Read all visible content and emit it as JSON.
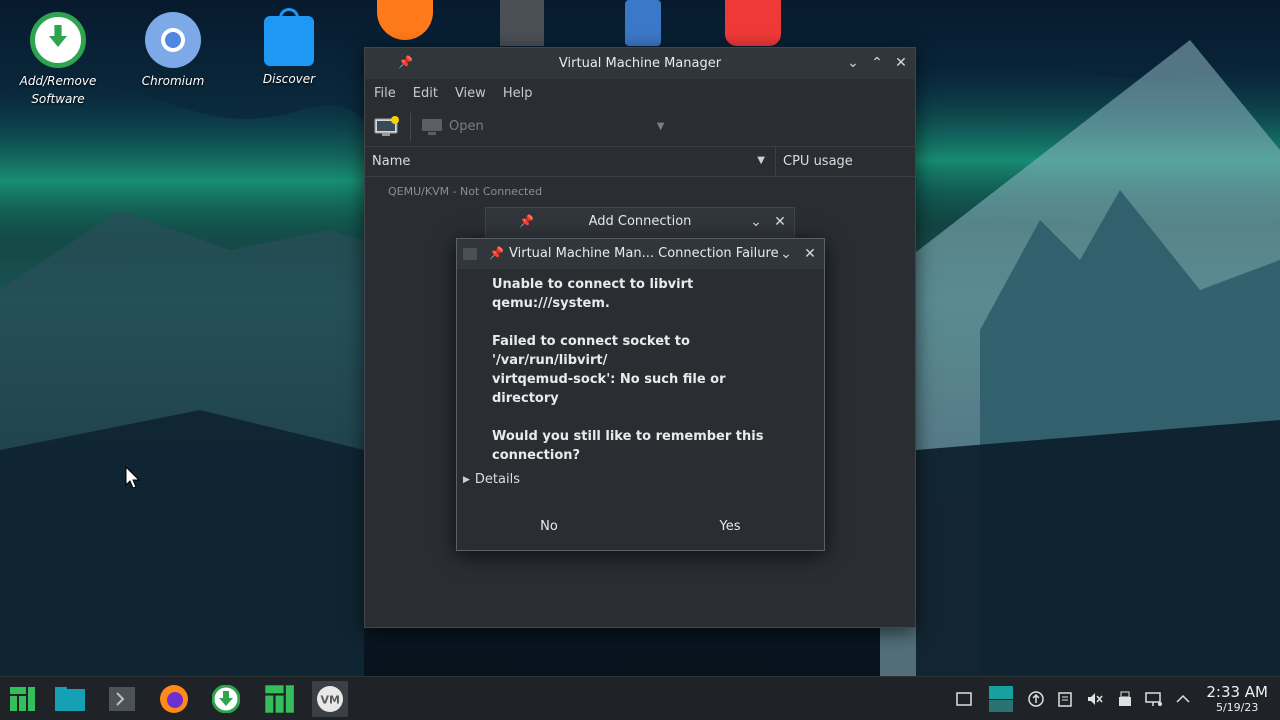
{
  "desktop": {
    "icons": [
      {
        "label_line1": "Add/Remove",
        "label_line2": "Software"
      },
      {
        "label_line1": "Chromium",
        "label_line2": ""
      },
      {
        "label_line1": "Discover",
        "label_line2": ""
      }
    ]
  },
  "vmm": {
    "title": "Virtual Machine Manager",
    "menu": [
      "File",
      "Edit",
      "View",
      "Help"
    ],
    "toolbar": {
      "open_label": "Open"
    },
    "columns": {
      "name": "Name",
      "cpu": "CPU usage"
    },
    "connection": "QEMU/KVM - Not Connected"
  },
  "add_connection": {
    "title": "Add Connection"
  },
  "dialog": {
    "title": "Virtual Machine Man... Connection Failure",
    "line1": "Unable to connect to libvirt qemu:///system.",
    "line2": "Failed to connect socket to '/var/run/libvirt/",
    "line3": "virtqemud-sock': No such file or",
    "line4": "directory",
    "line5": "Would you still like to remember this",
    "line6": "connection?",
    "details": "Details",
    "no": "No",
    "yes": "Yes"
  },
  "clock": {
    "time": "2:33 AM",
    "date": "5/19/23"
  },
  "colors": {
    "panel": "#1f2327",
    "window": "#2a2e32",
    "titlebar": "#31363b",
    "accent": "#35bf5c"
  }
}
